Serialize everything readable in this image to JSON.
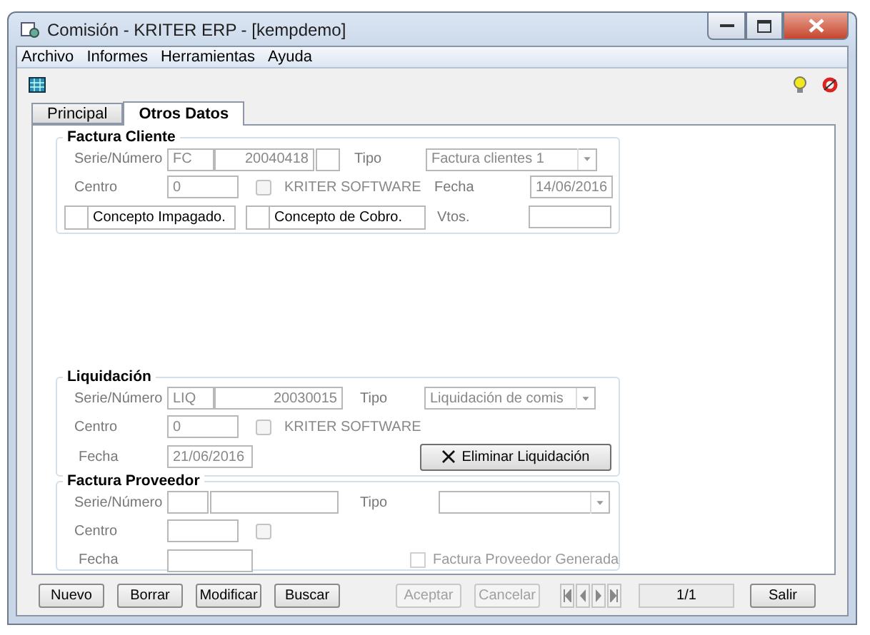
{
  "window": {
    "title": "Comisión - KRITER ERP - [kempdemo]"
  },
  "menu": [
    "Archivo",
    "Informes",
    "Herramientas",
    "Ayuda"
  ],
  "tabs": [
    {
      "label": "Principal",
      "selected": false
    },
    {
      "label": "Otros Datos",
      "selected": true
    }
  ],
  "factura_cliente": {
    "title": "Factura Cliente",
    "serie_label": "Serie/Número",
    "serie": "FC",
    "numero": "20040418",
    "tipo_label": "Tipo",
    "tipo": "Factura clientes 1",
    "centro_label": "Centro",
    "centro": "0",
    "centro_name": "KRITER SOFTWARE",
    "fecha_label": "Fecha",
    "fecha": "14/06/2016",
    "checks": [
      {
        "label": "Concepto Impagado.",
        "checked": false
      },
      {
        "label": "Concepto de Cobro.",
        "checked": false
      }
    ],
    "vtos_label": "Vtos."
  },
  "liquidacion": {
    "title": "Liquidación",
    "serie_label": "Serie/Número",
    "serie": "LIQ",
    "numero": "20030015",
    "tipo_label": "Tipo",
    "tipo": "Liquidación de comis",
    "centro_label": "Centro",
    "centro": "0",
    "centro_name": "KRITER SOFTWARE",
    "fecha_label": "Fecha",
    "fecha": "21/06/2016",
    "delete_button": "Eliminar Liquidación"
  },
  "factura_proveedor": {
    "title": "Factura Proveedor",
    "serie_label": "Serie/Número",
    "tipo_label": "Tipo",
    "centro_label": "Centro",
    "fecha_label": "Fecha",
    "generada": {
      "label": "Factura Proveedor Generada",
      "checked": false,
      "disabled": true
    }
  },
  "footer": {
    "buttons": [
      {
        "label": "Nuevo",
        "disabled": false
      },
      {
        "label": "Borrar",
        "disabled": false
      },
      {
        "label": "Modificar",
        "disabled": false
      },
      {
        "label": "Buscar",
        "disabled": false
      }
    ],
    "confirm_buttons": [
      {
        "label": "Aceptar",
        "disabled": true
      },
      {
        "label": "Cancelar",
        "disabled": true
      }
    ],
    "record": "1/1",
    "exit": "Salir"
  }
}
